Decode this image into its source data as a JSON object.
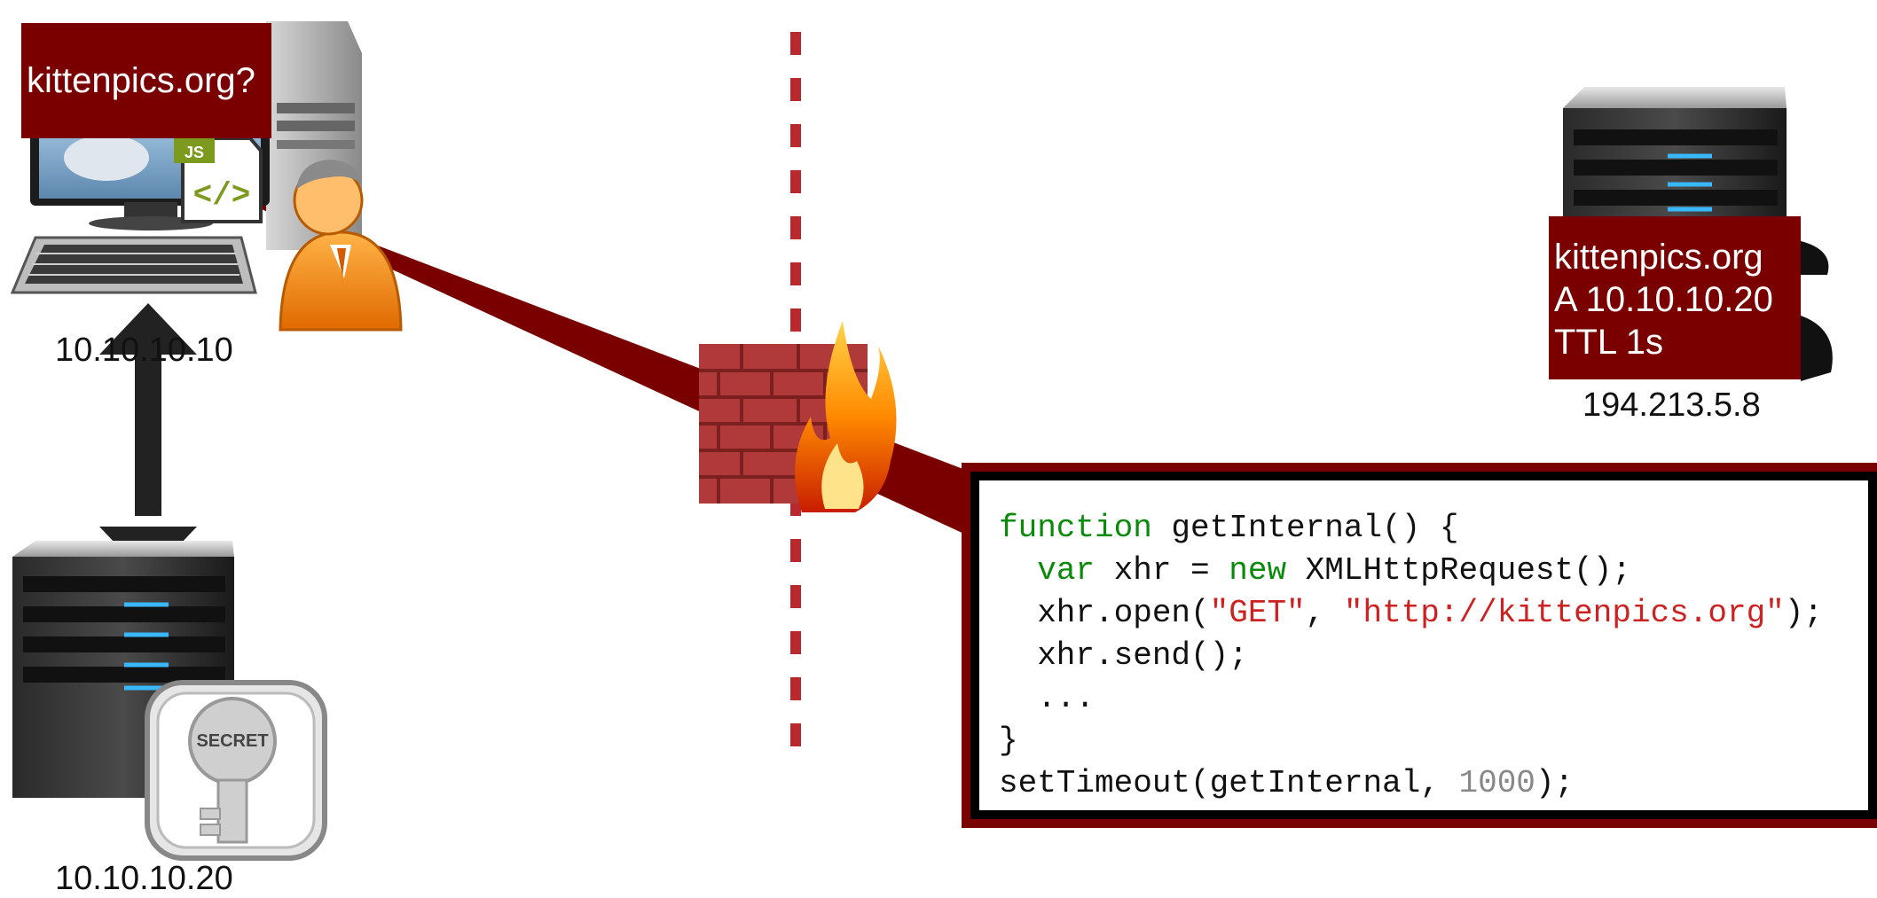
{
  "client": {
    "query_text": "kittenpics.org?",
    "ip": "10.10.10.10"
  },
  "internal_server": {
    "ip": "10.10.10.20",
    "key_label": "SECRET"
  },
  "dns_server": {
    "record_lines": [
      "kittenpics.org",
      "A 10.10.10.20",
      "TTL 1s"
    ],
    "ip": "194.213.5.8"
  },
  "script_badge": "JS",
  "code": {
    "lines": [
      [
        {
          "t": "function",
          "c": "kw"
        },
        {
          "t": " getInternal() {"
        }
      ],
      [
        {
          "t": "  "
        },
        {
          "t": "var",
          "c": "kw"
        },
        {
          "t": " xhr = "
        },
        {
          "t": "new",
          "c": "kw"
        },
        {
          "t": " XMLHttpRequest();"
        }
      ],
      [
        {
          "t": "  xhr.open("
        },
        {
          "t": "\"GET\"",
          "c": "str"
        },
        {
          "t": ", "
        },
        {
          "t": "\"http://kittenpics.org\"",
          "c": "str"
        },
        {
          "t": ");"
        }
      ],
      [
        {
          "t": "  xhr.send();"
        }
      ],
      [
        {
          "t": "  ..."
        }
      ],
      [
        {
          "t": "}"
        }
      ],
      [
        {
          "t": "setTimeout(getInternal, "
        },
        {
          "t": "1000",
          "c": "num"
        },
        {
          "t": ");"
        }
      ]
    ]
  },
  "colors": {
    "accent_dark_red": "#7a0000",
    "firewall_brick": "#b03a3a",
    "keyword_green": "#0a8a0a",
    "string_red": "#cc2222"
  }
}
